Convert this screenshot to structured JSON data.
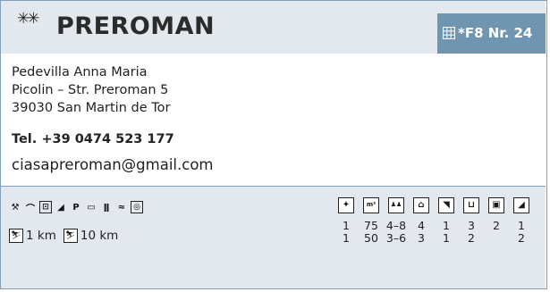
{
  "header": {
    "stars": "✳✳",
    "name": "PREROMAN",
    "ref": "*F8 Nr. 24"
  },
  "contact": {
    "owner": "Pedevilla Anna Maria",
    "street": "Picolin – Str. Preroman 5",
    "city": "39030 San Martin de Tor",
    "phone": "Tel. +39 0474 523 177",
    "email": "ciasapreroman@gmail.com"
  },
  "amenities": [
    {
      "name": "hammer-icon",
      "glyph": "⚒"
    },
    {
      "name": "cable-car-icon",
      "glyph": "⌒"
    },
    {
      "name": "washing-machine-icon",
      "glyph": "⊡"
    },
    {
      "name": "iron-icon",
      "glyph": "◢"
    },
    {
      "name": "parking-icon",
      "glyph": "P"
    },
    {
      "name": "bus-icon",
      "glyph": "▭"
    },
    {
      "name": "restaurant-icon",
      "glyph": "ǁ"
    },
    {
      "name": "sauna-icon",
      "glyph": "≈"
    },
    {
      "name": "tv-icon",
      "glyph": "◎"
    }
  ],
  "distances": [
    {
      "icon": "ski-lift-icon",
      "value": "1 km"
    },
    {
      "icon": "cross-country-ski-icon",
      "value": "10 km"
    }
  ],
  "room_columns": [
    {
      "name": "apartment-icon",
      "glyph": "✦"
    },
    {
      "name": "area-icon",
      "glyph": "m²"
    },
    {
      "name": "persons-icon",
      "glyph": "♟♟"
    },
    {
      "name": "rooms-icon",
      "glyph": "⌂"
    },
    {
      "name": "kitchen-icon",
      "glyph": "◥"
    },
    {
      "name": "bathroom-icon",
      "glyph": "⊔"
    },
    {
      "name": "bedroom-icon",
      "glyph": "▣"
    },
    {
      "name": "stairs-icon",
      "glyph": "◢"
    }
  ],
  "room_rows": [
    [
      "1",
      "75",
      "4–8",
      "4",
      "1",
      "3",
      "2",
      "1"
    ],
    [
      "1",
      "50",
      "3–6",
      "3",
      "1",
      "2",
      "",
      "2"
    ]
  ]
}
